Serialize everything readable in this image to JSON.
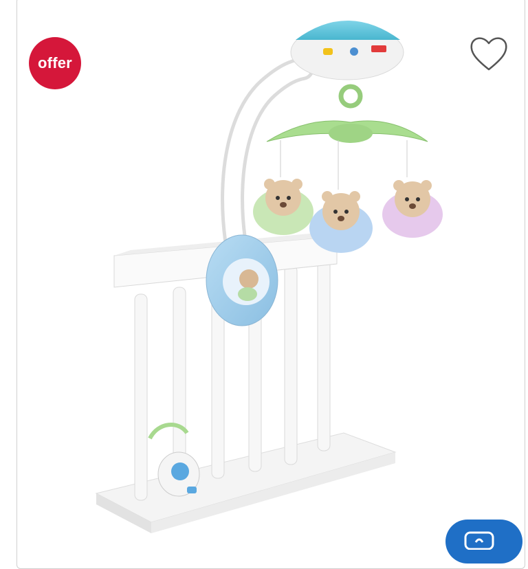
{
  "badge": {
    "label": "offer",
    "color": "#d5173a"
  },
  "wishlist": {
    "icon": "heart-outline-icon"
  },
  "product": {
    "image": "crib-mobile-with-hanging-bear-plush-toys"
  },
  "fab": {
    "icon": "chat-icon",
    "color": "#1f6fc6"
  }
}
